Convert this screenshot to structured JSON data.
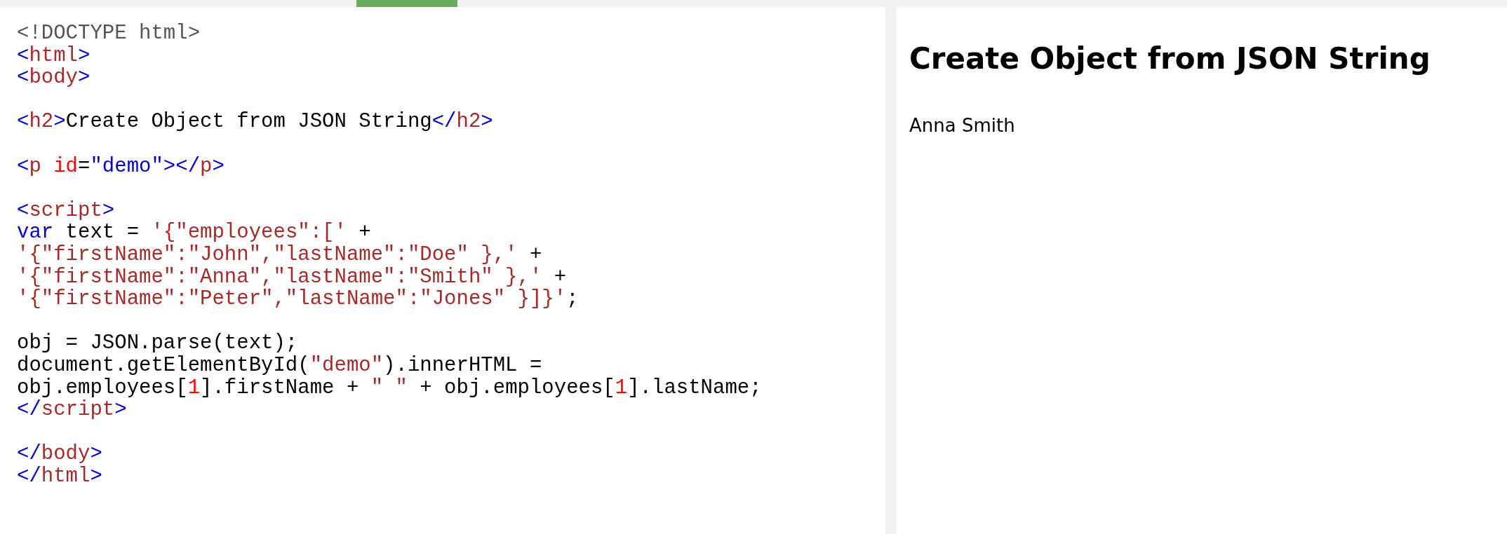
{
  "editor": {
    "tab_indicator": {
      "selected": true
    },
    "lines": [
      {
        "kind": "code",
        "tokens": [
          {
            "text": "<!DOCTYPE html>",
            "kind": "doctype"
          }
        ]
      },
      {
        "kind": "code",
        "tokens": [
          {
            "text": "<",
            "kind": "bracket"
          },
          {
            "text": "html",
            "kind": "tagname"
          },
          {
            "text": ">",
            "kind": "bracket"
          }
        ]
      },
      {
        "kind": "code",
        "tokens": [
          {
            "text": "<",
            "kind": "bracket"
          },
          {
            "text": "body",
            "kind": "tagname"
          },
          {
            "text": ">",
            "kind": "bracket"
          }
        ]
      },
      {
        "kind": "blank"
      },
      {
        "kind": "code",
        "tokens": [
          {
            "text": "<",
            "kind": "bracket"
          },
          {
            "text": "h2",
            "kind": "tagname"
          },
          {
            "text": ">",
            "kind": "bracket"
          },
          {
            "text": "Create Object from JSON String",
            "kind": "plain"
          },
          {
            "text": "</",
            "kind": "bracket"
          },
          {
            "text": "h2",
            "kind": "tagname"
          },
          {
            "text": ">",
            "kind": "bracket"
          }
        ]
      },
      {
        "kind": "blank"
      },
      {
        "kind": "code",
        "tokens": [
          {
            "text": "<",
            "kind": "bracket"
          },
          {
            "text": "p",
            "kind": "tagname"
          },
          {
            "text": " id",
            "kind": "attr"
          },
          {
            "text": "=",
            "kind": "plain"
          },
          {
            "text": "\"demo\"",
            "kind": "attrval"
          },
          {
            "text": "></",
            "kind": "bracket"
          },
          {
            "text": "p",
            "kind": "tagname"
          },
          {
            "text": ">",
            "kind": "bracket"
          }
        ]
      },
      {
        "kind": "blank"
      },
      {
        "kind": "code",
        "tokens": [
          {
            "text": "<",
            "kind": "bracket"
          },
          {
            "text": "script",
            "kind": "tagname"
          },
          {
            "text": ">",
            "kind": "bracket"
          }
        ]
      },
      {
        "kind": "code",
        "tokens": [
          {
            "text": "var",
            "kind": "keyword"
          },
          {
            "text": " text = ",
            "kind": "plain"
          },
          {
            "text": "'{\"employees\":['",
            "kind": "string"
          },
          {
            "text": " +",
            "kind": "plain"
          }
        ]
      },
      {
        "kind": "code",
        "tokens": [
          {
            "text": "'{\"firstName\":\"John\",\"lastName\":\"Doe\" },'",
            "kind": "string"
          },
          {
            "text": " +",
            "kind": "plain"
          }
        ]
      },
      {
        "kind": "code",
        "tokens": [
          {
            "text": "'{\"firstName\":\"Anna\",\"lastName\":\"Smith\" },'",
            "kind": "string"
          },
          {
            "text": " +",
            "kind": "plain"
          }
        ]
      },
      {
        "kind": "code",
        "tokens": [
          {
            "text": "'{\"firstName\":\"Peter\",\"lastName\":\"Jones\" }]}'",
            "kind": "string"
          },
          {
            "text": ";",
            "kind": "plain"
          }
        ]
      },
      {
        "kind": "blank"
      },
      {
        "kind": "code",
        "tokens": [
          {
            "text": "obj = JSON.parse(text);",
            "kind": "plain"
          }
        ]
      },
      {
        "kind": "code",
        "tokens": [
          {
            "text": "document.getElementById(",
            "kind": "plain"
          },
          {
            "text": "\"demo\"",
            "kind": "string"
          },
          {
            "text": ").innerHTML =",
            "kind": "plain"
          }
        ]
      },
      {
        "kind": "code",
        "tokens": [
          {
            "text": "obj.employees[",
            "kind": "plain"
          },
          {
            "text": "1",
            "kind": "number"
          },
          {
            "text": "].firstName + ",
            "kind": "plain"
          },
          {
            "text": "\" \"",
            "kind": "string"
          },
          {
            "text": " + obj.employees[",
            "kind": "plain"
          },
          {
            "text": "1",
            "kind": "number"
          },
          {
            "text": "].lastName;",
            "kind": "plain"
          }
        ]
      },
      {
        "kind": "code",
        "tokens": [
          {
            "text": "</",
            "kind": "bracket"
          },
          {
            "text": "script",
            "kind": "tagname"
          },
          {
            "text": ">",
            "kind": "bracket"
          }
        ]
      },
      {
        "kind": "blank"
      },
      {
        "kind": "code",
        "tokens": [
          {
            "text": "</",
            "kind": "bracket"
          },
          {
            "text": "body",
            "kind": "tagname"
          },
          {
            "text": ">",
            "kind": "bracket"
          }
        ]
      },
      {
        "kind": "code",
        "tokens": [
          {
            "text": "</",
            "kind": "bracket"
          },
          {
            "text": "html",
            "kind": "tagname"
          },
          {
            "text": ">",
            "kind": "bracket"
          }
        ]
      }
    ]
  },
  "result": {
    "heading": "Create Object from JSON String",
    "paragraph": "Anna Smith"
  }
}
